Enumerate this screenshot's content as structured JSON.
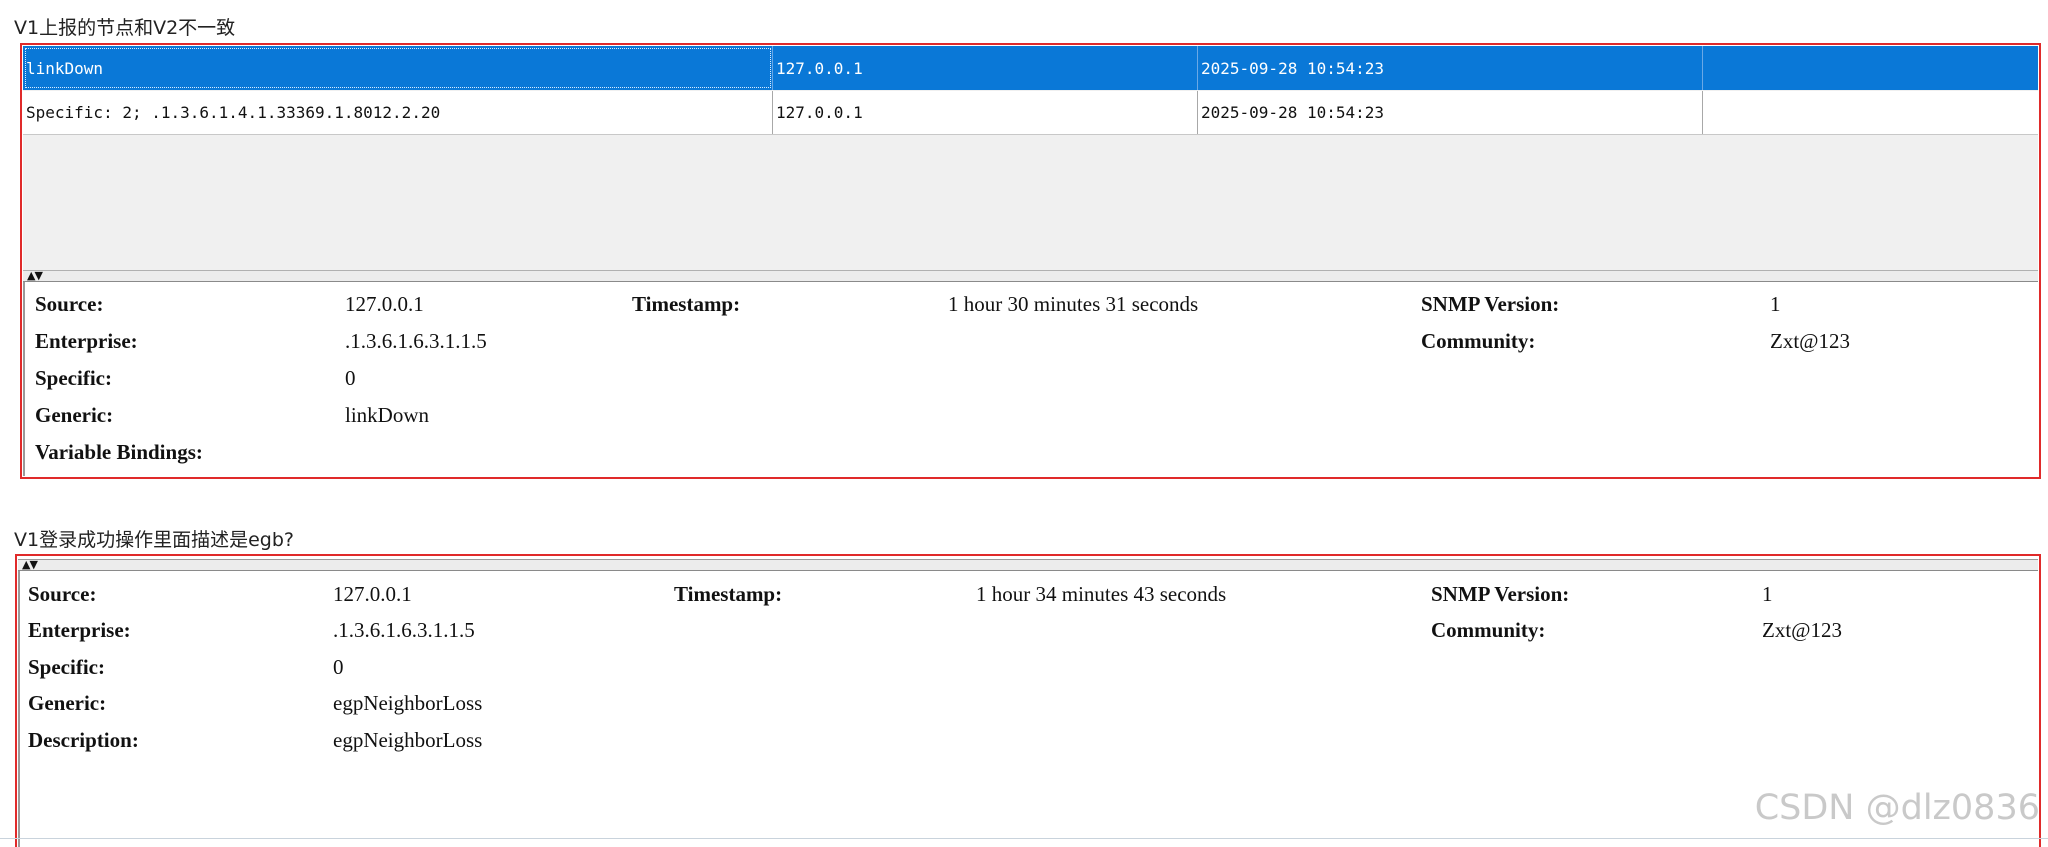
{
  "captions": {
    "first": "V1上报的节点和V2不一致",
    "second": "V1登录成功操作里面描述是egb?"
  },
  "colors": {
    "highlight_border": "#e02a2a",
    "selection": "#0a78d7"
  },
  "trap_list": {
    "rows": [
      {
        "name": "linkDown",
        "source": "127.0.0.1",
        "time": "2025-09-28 10:54:23",
        "extra": "",
        "selected": true
      },
      {
        "name": "Specific: 2; .1.3.6.1.4.1.33369.1.8012.2.20",
        "source": "127.0.0.1",
        "time": "2025-09-28 10:54:23",
        "extra": "",
        "selected": false
      }
    ]
  },
  "details_1": {
    "source_label": "Source:",
    "source_value": "127.0.0.1",
    "timestamp_label": "Timestamp:",
    "timestamp_value": "1 hour 30 minutes 31 seconds",
    "snmp_label": "SNMP Version:",
    "snmp_value": "1",
    "enterprise_label": "Enterprise:",
    "enterprise_value": ".1.3.6.1.6.3.1.1.5",
    "community_label": "Community:",
    "community_value": "Zxt@123",
    "specific_label": "Specific:",
    "specific_value": "0",
    "generic_label": "Generic:",
    "generic_value": "linkDown",
    "bindings_label": "Variable Bindings:"
  },
  "details_2": {
    "source_label": "Source:",
    "source_value": "127.0.0.1",
    "timestamp_label": "Timestamp:",
    "timestamp_value": "1 hour 34 minutes 43 seconds",
    "snmp_label": "SNMP Version:",
    "snmp_value": "1",
    "enterprise_label": "Enterprise:",
    "enterprise_value": ".1.3.6.1.6.3.1.1.5",
    "community_label": "Community:",
    "community_value": "Zxt@123",
    "specific_label": "Specific:",
    "specific_value": "0",
    "generic_label": "Generic:",
    "generic_value": "egpNeighborLoss",
    "description_label": "Description:",
    "description_value": "egpNeighborLoss"
  },
  "watermark": "CSDN @dlz0836"
}
